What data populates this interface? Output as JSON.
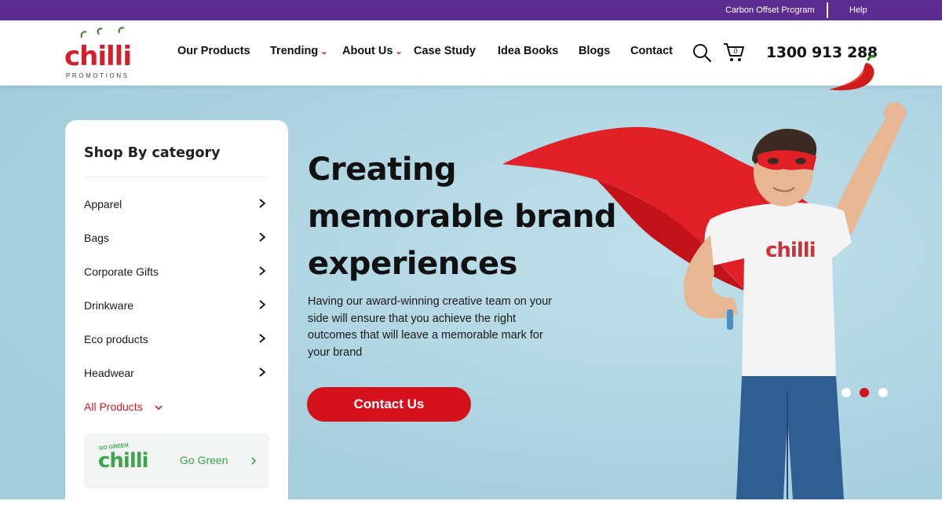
{
  "topbar": {
    "carbon_offset": "Carbon Offset Program",
    "help": "Help"
  },
  "brand": {
    "name": "chilli",
    "tagline": "PROMOTIONS"
  },
  "nav": {
    "items": [
      {
        "label": "Our Products"
      },
      {
        "label": "Trending"
      },
      {
        "label": "About Us"
      },
      {
        "label": "Case Study"
      },
      {
        "label": "Idea Books"
      },
      {
        "label": "Blogs"
      },
      {
        "label": "Contact"
      }
    ],
    "cart_count": "0",
    "phone": "1300 913 288"
  },
  "sidebar": {
    "title": "Shop By category",
    "categories": [
      {
        "label": "Apparel"
      },
      {
        "label": "Bags"
      },
      {
        "label": "Corporate Gifts"
      },
      {
        "label": "Drinkware"
      },
      {
        "label": "Eco products"
      },
      {
        "label": "Headwear"
      }
    ],
    "all_products": "All Products",
    "go_green": {
      "badge_top": "GO GREEN",
      "badge_logo": "chilli",
      "label": "Go Green"
    }
  },
  "hero": {
    "title_line1": "Creating",
    "title_line2": "memorable brand",
    "title_line3": "experiences",
    "description": "Having our award-winning creative team on your side will ensure that you achieve the right outcomes that will leave a memorable mark for your brand",
    "cta": "Contact Us",
    "shirt_logo": "chilli",
    "slide_count": 3,
    "active_slide": 2
  },
  "colors": {
    "brand_red": "#d4111d",
    "topbar_purple": "#5b2d91",
    "hero_bg": "#a9d2e0",
    "green": "#3aa64a"
  },
  "icons": [
    "search-icon",
    "cart-icon",
    "chevron-right-icon",
    "chevron-down-icon",
    "chilli-pepper-icon"
  ]
}
